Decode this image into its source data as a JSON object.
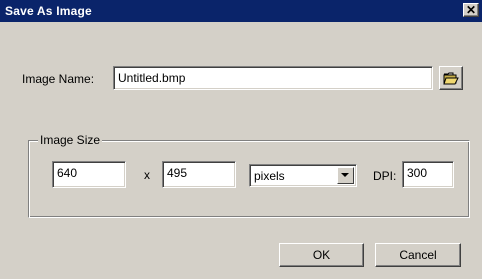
{
  "window": {
    "title": "Save As Image",
    "close_glyph": "✕",
    "close_icon": "close-icon"
  },
  "image_name": {
    "label": "Image Name:",
    "value": "Untitled.bmp",
    "browse_icon": "folder-open-icon"
  },
  "image_size": {
    "group_label": "Image Size",
    "width": "640",
    "separator": "x",
    "height": "495",
    "units": "pixels",
    "dpi_label": "DPI:",
    "dpi": "300"
  },
  "buttons": {
    "ok": "OK",
    "cancel": "Cancel"
  },
  "colors": {
    "title_bar": "#0a246a",
    "dialog_face": "#d4d0c8",
    "field_background": "#ffffff"
  }
}
